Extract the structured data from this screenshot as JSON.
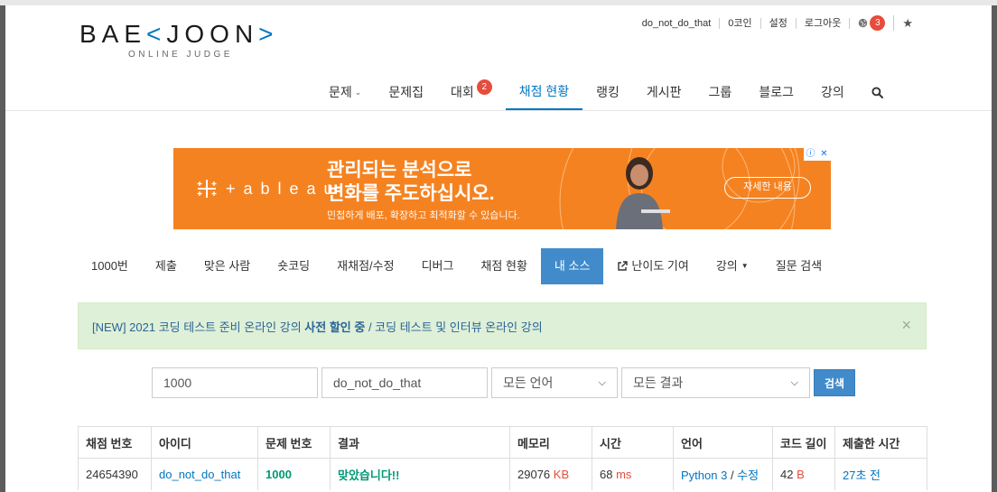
{
  "logo": {
    "main_left": "BAE",
    "main_bracket_l": "<",
    "main_right": "JOON",
    "main_bracket_r": ">",
    "sub": "ONLINE JUDGE"
  },
  "topbar": {
    "username": "do_not_do_that",
    "coins": "0코인",
    "settings": "설정",
    "logout": "로그아웃",
    "notif_count": "3"
  },
  "nav": {
    "items": [
      "문제",
      "문제집",
      "대회",
      "채점 현황",
      "랭킹",
      "게시판",
      "그룹",
      "블로그",
      "강의"
    ],
    "contest_badge": "2"
  },
  "ad": {
    "brand": "+ a b l e a u",
    "headline_1": "관리되는 분석으로",
    "headline_2": "변화를 주도하십시오.",
    "sub": "민첩하게 배포, 확장하고 최적화할 수 있습니다.",
    "button": "자세한 내용"
  },
  "subnav": {
    "items": [
      "1000번",
      "제출",
      "맞은 사람",
      "숏코딩",
      "재채점/수정",
      "디버그",
      "채점 현황",
      "내 소스",
      "난이도 기여",
      "강의",
      "질문 검색"
    ]
  },
  "alert": {
    "part1": "[NEW] 2021 코딩 테스트 준비 온라인 강의",
    "part2": "사전 할인 중",
    "part3": " / 코딩 테스트 및 인터뷰 온라인 강의",
    "close": "×"
  },
  "form": {
    "problem_value": "1000",
    "user_value": "do_not_do_that",
    "language_value": "모든 언어",
    "result_value": "모든 결과",
    "search_label": "검색"
  },
  "table": {
    "headers": [
      "채점 번호",
      "아이디",
      "문제 번호",
      "결과",
      "메모리",
      "시간",
      "언어",
      "코드 길이",
      "제출한 시간"
    ],
    "row": {
      "id": "24654390",
      "user": "do_not_do_that",
      "problem": "1000",
      "result": "맞았습니다!!",
      "memory": "29076",
      "memory_unit": "KB",
      "time": "68",
      "time_unit": "ms",
      "language": "Python 3",
      "edit": "수정",
      "length": "42",
      "length_unit": "B",
      "submitted": "27초 전"
    }
  },
  "colors": {
    "accent": "#0076c0",
    "ad_orange": "#f58220",
    "success_green": "#009874",
    "alert_bg": "#dff0d8"
  }
}
